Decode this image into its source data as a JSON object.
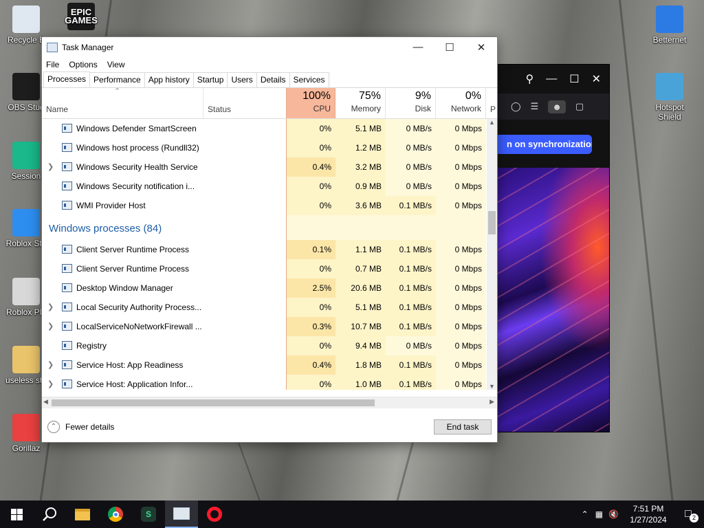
{
  "desktop": {
    "icons_left": [
      {
        "label": "Recycle B",
        "icon": "recycle-bin-icon",
        "color": "#dfe8f0"
      },
      {
        "label": "OBS Stud",
        "icon": "obs-icon",
        "color": "#1d1d1d"
      },
      {
        "label": "Session",
        "icon": "session-icon",
        "color": "#1ab88a"
      },
      {
        "label": "Roblox Stu",
        "icon": "roblox-studio-icon",
        "color": "#2d8ef0"
      },
      {
        "label": "Roblox Pla",
        "icon": "roblox-player-icon",
        "color": "#d8d8d8"
      },
      {
        "label": "useless stu",
        "icon": "folder-icon",
        "color": "#e9c46a"
      },
      {
        "label": "Gorillaz",
        "icon": "gorillaz-icon",
        "color": "#e94040"
      }
    ],
    "epic": {
      "label": "EPIC\nGAMES"
    },
    "icons_right": [
      {
        "label": "Betternet",
        "icon": "betternet-icon",
        "color": "#2c7be5"
      },
      {
        "label": "Hotspot\nShield",
        "icon": "hotspot-shield-icon",
        "color": "#4aa3d8"
      }
    ]
  },
  "browser": {
    "sync_text": "n on synchronization"
  },
  "taskmgr": {
    "title": "Task Manager",
    "menu": [
      "File",
      "Options",
      "View"
    ],
    "tabs": [
      "Processes",
      "Performance",
      "App history",
      "Startup",
      "Users",
      "Details",
      "Services"
    ],
    "columns": {
      "name": "Name",
      "status": "Status",
      "cpu_pct": "100%",
      "cpu": "CPU",
      "mem_pct": "75%",
      "mem": "Memory",
      "disk_pct": "9%",
      "disk": "Disk",
      "net_pct": "0%",
      "net": "Network",
      "power": "P"
    },
    "rows_top": [
      {
        "name": "Windows Defender SmartScreen",
        "chev": false,
        "cpu": "0%",
        "mem": "5.1 MB",
        "disk": "0 MB/s",
        "net": "0 Mbps"
      },
      {
        "name": "Windows host process (Rundll32)",
        "chev": false,
        "cpu": "0%",
        "mem": "1.2 MB",
        "disk": "0 MB/s",
        "net": "0 Mbps"
      },
      {
        "name": "Windows Security Health Service",
        "chev": true,
        "cpu": "0.4%",
        "mem": "3.2 MB",
        "disk": "0 MB/s",
        "net": "0 Mbps"
      },
      {
        "name": "Windows Security notification i...",
        "chev": false,
        "cpu": "0%",
        "mem": "0.9 MB",
        "disk": "0 MB/s",
        "net": "0 Mbps"
      },
      {
        "name": "WMI Provider Host",
        "chev": false,
        "cpu": "0%",
        "mem": "3.6 MB",
        "disk": "0.1 MB/s",
        "net": "0 Mbps"
      }
    ],
    "group_label": "Windows processes (84)",
    "rows_win": [
      {
        "name": "Client Server Runtime Process",
        "chev": false,
        "cpu": "0.1%",
        "mem": "1.1 MB",
        "disk": "0.1 MB/s",
        "net": "0 Mbps"
      },
      {
        "name": "Client Server Runtime Process",
        "chev": false,
        "cpu": "0%",
        "mem": "0.7 MB",
        "disk": "0.1 MB/s",
        "net": "0 Mbps"
      },
      {
        "name": "Desktop Window Manager",
        "chev": false,
        "cpu": "2.5%",
        "mem": "20.6 MB",
        "disk": "0.1 MB/s",
        "net": "0 Mbps"
      },
      {
        "name": "Local Security Authority Process...",
        "chev": true,
        "cpu": "0%",
        "mem": "5.1 MB",
        "disk": "0.1 MB/s",
        "net": "0 Mbps"
      },
      {
        "name": "LocalServiceNoNetworkFirewall ...",
        "chev": true,
        "cpu": "0.3%",
        "mem": "10.7 MB",
        "disk": "0.1 MB/s",
        "net": "0 Mbps"
      },
      {
        "name": "Registry",
        "chev": false,
        "cpu": "0%",
        "mem": "9.4 MB",
        "disk": "0 MB/s",
        "net": "0 Mbps"
      },
      {
        "name": "Service Host: App Readiness",
        "chev": true,
        "cpu": "0.4%",
        "mem": "1.8 MB",
        "disk": "0.1 MB/s",
        "net": "0 Mbps"
      },
      {
        "name": "Service Host: Application Infor...",
        "chev": true,
        "cpu": "0%",
        "mem": "1.0 MB",
        "disk": "0.1 MB/s",
        "net": "0 Mbps"
      }
    ],
    "fewer_details": "Fewer details",
    "end_task": "End task"
  },
  "taskbar": {
    "time": "7:51 PM",
    "date": "1/27/2024",
    "notif_count": "2"
  },
  "colors": {
    "cpu_header": "#f7b79a",
    "cpu_cell": "#fbe6a8",
    "cell_light": "#fdf4c8",
    "cell_lighter": "#fff9dc",
    "accent": "#1f5ea8"
  }
}
